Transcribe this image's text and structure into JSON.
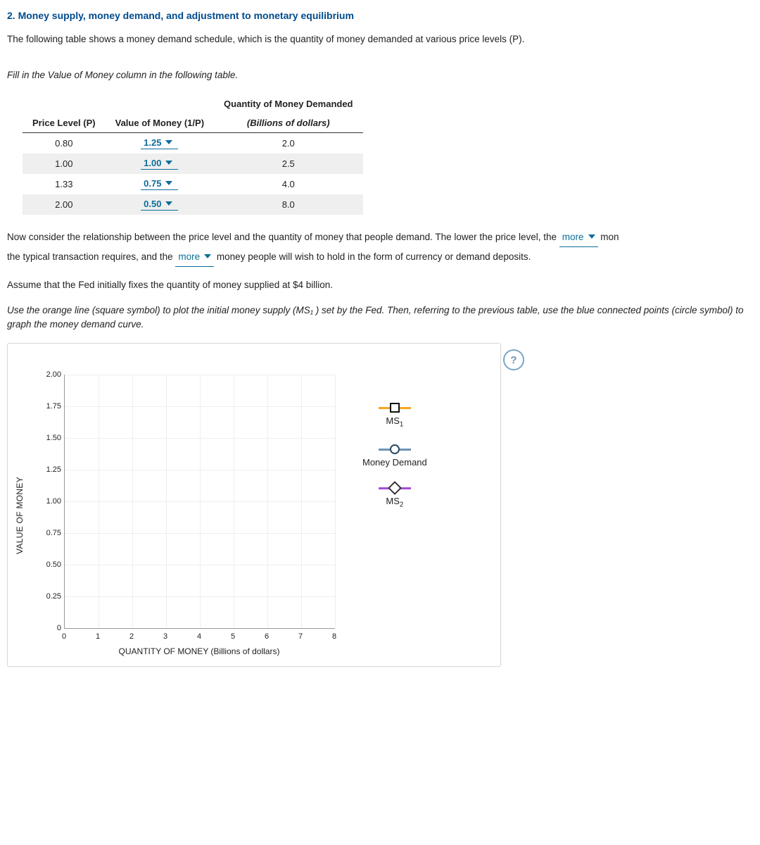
{
  "heading": "2. Money supply, money demand, and adjustment to monetary equilibrium",
  "intro": "The following table shows a money demand schedule, which is the quantity of money demanded at various price levels (P).",
  "instr_table": "Fill in the Value of Money column in the following table.",
  "table": {
    "col1": "Price Level (P)",
    "col2": "Value of Money (1/P)",
    "col3a": "Quantity of Money Demanded",
    "col3b": "(Billions of dollars)",
    "rows": [
      {
        "p": "0.80",
        "v": "1.25",
        "q": "2.0"
      },
      {
        "p": "1.00",
        "v": "1.00",
        "q": "2.5"
      },
      {
        "p": "1.33",
        "v": "0.75",
        "q": "4.0"
      },
      {
        "p": "2.00",
        "v": "0.50",
        "q": "8.0"
      }
    ]
  },
  "para2": {
    "a": "Now consider the relationship between the price level and the quantity of money that people demand. The lower the price level, the ",
    "dd1": "more",
    "b": " mon",
    "c": "the typical transaction requires, and the ",
    "dd2": "more",
    "d": " money people will wish to hold in the form of currency or demand deposits."
  },
  "para3": "Assume that the Fed initially fixes the quantity of money supplied at $4 billion.",
  "para4": "Use the orange line (square symbol) to plot the initial money supply (MS₁ ) set by the Fed. Then, referring to the previous table, use the blue connected points (circle symbol) to graph the money demand curve.",
  "help": "?",
  "chart_data": {
    "type": "scatter",
    "title": "",
    "xlabel": "QUANTITY OF MONEY (Billions of dollars)",
    "ylabel": "VALUE OF MONEY",
    "xlim": [
      0,
      8
    ],
    "ylim": [
      0,
      2
    ],
    "xticks": [
      0,
      1,
      2,
      3,
      4,
      5,
      6,
      7,
      8
    ],
    "yticks": [
      0,
      0.25,
      0.5,
      0.75,
      1.0,
      1.25,
      1.5,
      1.75,
      2.0
    ],
    "ytick_labels": [
      "0",
      "0.25",
      "0.50",
      "0.75",
      "1.00",
      "1.25",
      "1.50",
      "1.75",
      "2.00"
    ],
    "series": [
      {
        "name": "MS1",
        "label": "MS₁",
        "symbol": "square",
        "color": "#f5a623",
        "values": []
      },
      {
        "name": "Money Demand",
        "label": "Money Demand",
        "symbol": "circle",
        "color": "#6d93b5",
        "values": []
      },
      {
        "name": "MS2",
        "label": "MS₂",
        "symbol": "diamond",
        "color": "#a64dd6",
        "values": []
      }
    ],
    "legend_position": "right",
    "grid": true
  }
}
